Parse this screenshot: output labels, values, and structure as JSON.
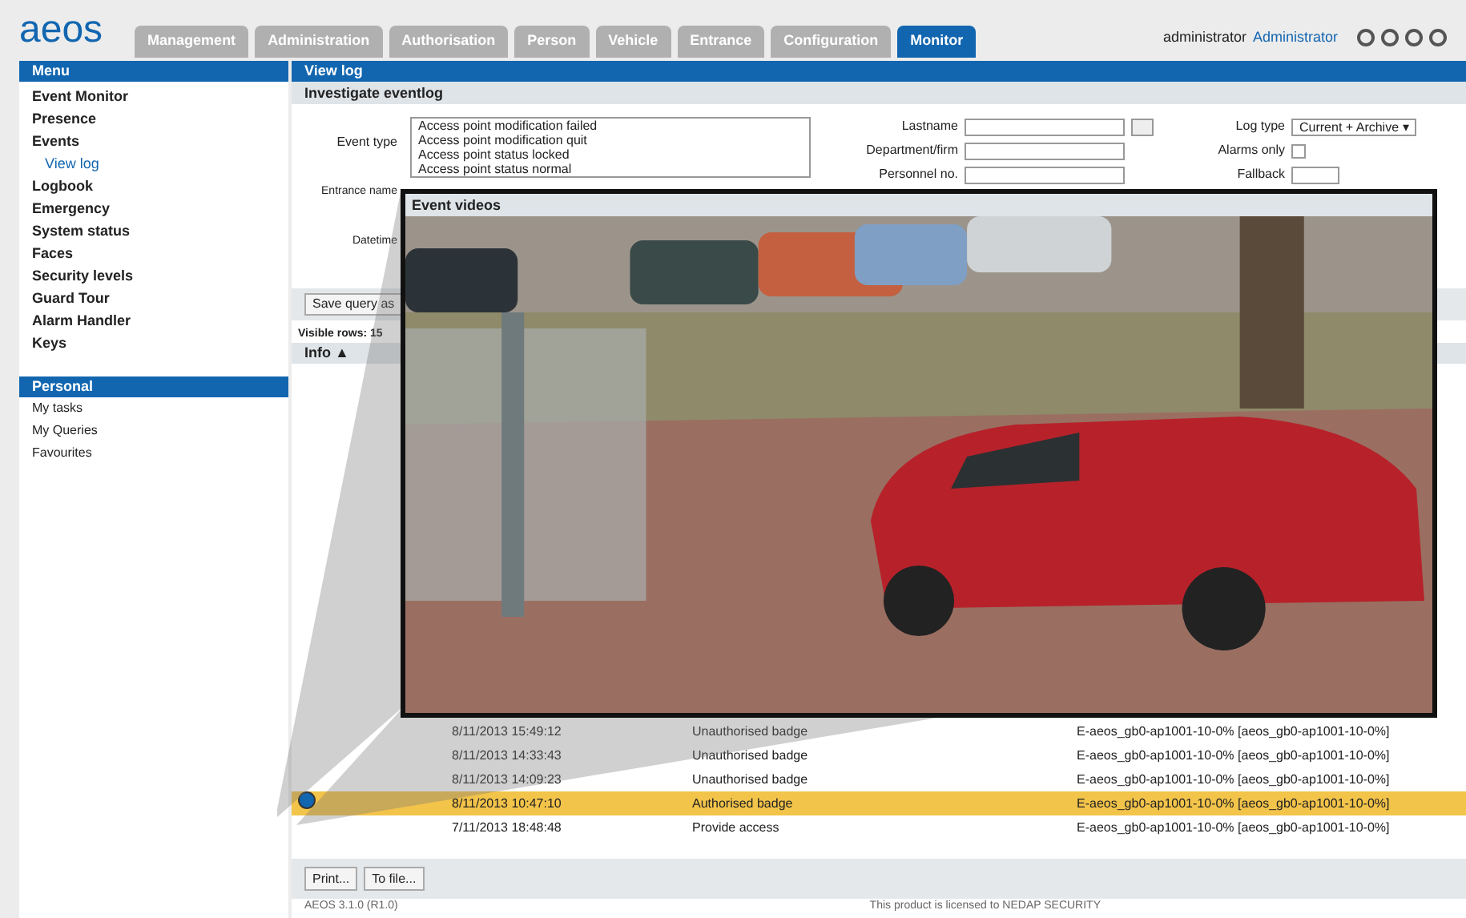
{
  "logo": "aeos",
  "tabs": [
    {
      "label": "Management",
      "selected": false
    },
    {
      "label": "Administration",
      "selected": false
    },
    {
      "label": "Authorisation",
      "selected": false
    },
    {
      "label": "Person",
      "selected": false
    },
    {
      "label": "Vehicle",
      "selected": false
    },
    {
      "label": "Entrance",
      "selected": false
    },
    {
      "label": "Configuration",
      "selected": false
    },
    {
      "label": "Monitor",
      "selected": true
    }
  ],
  "user": {
    "name": "administrator",
    "role": "Administrator"
  },
  "sidebar": {
    "title": "Menu",
    "items": [
      {
        "label": "Event Monitor",
        "selected": false
      },
      {
        "label": "Presence",
        "selected": false
      },
      {
        "label": "Events",
        "selected": false,
        "children": [
          {
            "label": "View log",
            "selected": true
          }
        ]
      },
      {
        "label": "Logbook",
        "selected": false
      },
      {
        "label": "Emergency",
        "selected": false
      },
      {
        "label": "System status",
        "selected": false
      },
      {
        "label": "Faces",
        "selected": false
      },
      {
        "label": "Security levels",
        "selected": false
      },
      {
        "label": "Guard Tour",
        "selected": false
      },
      {
        "label": "Alarm Handler",
        "selected": false
      },
      {
        "label": "Keys",
        "selected": false
      }
    ],
    "personal_title": "Personal",
    "personal_items": [
      "My tasks",
      "My Queries",
      "Favourites"
    ]
  },
  "page_title": "View log",
  "section_title": "Investigate eventlog",
  "form": {
    "event_type_label": "Event type",
    "event_types": [
      "Access point modification failed",
      "Access point modification quit",
      "Access point status locked",
      "Access point status normal"
    ],
    "entrance_label": "Entrance name",
    "datetime_label": "Datetime",
    "person_fields": [
      "Lastname",
      "Department/firm",
      "Personnel no."
    ],
    "log_type_label": "Log type",
    "log_type": "Current + Archive",
    "log_type_arrow": "▾",
    "alarms_label": "Alarms only",
    "alarms_only": false,
    "fallback_label": "Fallback"
  },
  "save_button": "Save query as",
  "visible_rows": "Visible rows: 15",
  "info_column": "Info ▲",
  "rows": [
    {
      "date": "8/11/2013 15:49:12",
      "event": "Unauthorised badge",
      "device": "E-aeos_gb0-ap1001-10-0% [aeos_gb0-ap1001-10-0%]",
      "selected": false
    },
    {
      "date": "8/11/2013 14:33:43",
      "event": "Unauthorised badge",
      "device": "E-aeos_gb0-ap1001-10-0% [aeos_gb0-ap1001-10-0%]",
      "selected": false
    },
    {
      "date": "8/11/2013 14:09:23",
      "event": "Unauthorised badge",
      "device": "E-aeos_gb0-ap1001-10-0% [aeos_gb0-ap1001-10-0%]",
      "selected": false
    },
    {
      "date": "8/11/2013 10:47:10",
      "event": "Authorised badge",
      "device": "E-aeos_gb0-ap1001-10-0% [aeos_gb0-ap1001-10-0%]",
      "selected": true
    },
    {
      "date": "7/11/2013 18:48:48",
      "event": "Provide access",
      "device": "E-aeos_gb0-ap1001-10-0% [aeos_gb0-ap1001-10-0%]",
      "selected": false
    }
  ],
  "bottom_buttons": [
    "Print...",
    "To file..."
  ],
  "footer": {
    "version": "AEOS 3.1.0 (R1.0)",
    "license": "This product is licensed to NEDAP SECURITY"
  },
  "video": {
    "title": "Event videos",
    "kind": "picture"
  }
}
